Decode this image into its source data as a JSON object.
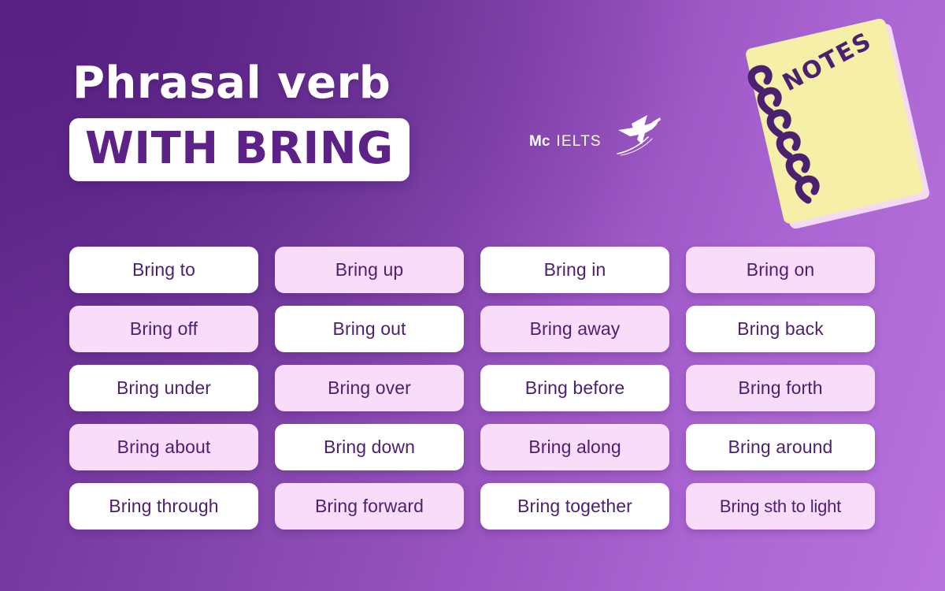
{
  "heading": {
    "line1": "Phrasal verb",
    "line2": "WITH BRING"
  },
  "brand": {
    "mc": "Mc",
    "ielts": "IELTS",
    "icon": "hummingbird-logo-icon"
  },
  "notebook": {
    "label": "NOTES",
    "cover_color": "#f6efa8",
    "page_color": "#f5daf5",
    "spiral_color": "#4b2070"
  },
  "colors": {
    "background_dark": "#6a2c96",
    "background_light": "#b972dc",
    "card_white": "#ffffff",
    "card_pink": "#f9dbfa",
    "text_purple": "#4d2070",
    "title_purple": "#5d2288"
  },
  "cards": [
    {
      "label": "Bring to",
      "style": "white"
    },
    {
      "label": "Bring up",
      "style": "pink"
    },
    {
      "label": "Bring in",
      "style": "white"
    },
    {
      "label": "Bring on",
      "style": "pink"
    },
    {
      "label": "Bring off",
      "style": "pink"
    },
    {
      "label": "Bring out",
      "style": "white"
    },
    {
      "label": "Bring away",
      "style": "pink"
    },
    {
      "label": "Bring back",
      "style": "white"
    },
    {
      "label": "Bring under",
      "style": "white"
    },
    {
      "label": "Bring over",
      "style": "pink"
    },
    {
      "label": "Bring before",
      "style": "white"
    },
    {
      "label": "Bring forth",
      "style": "pink"
    },
    {
      "label": "Bring about",
      "style": "pink"
    },
    {
      "label": "Bring down",
      "style": "white"
    },
    {
      "label": "Bring along",
      "style": "pink"
    },
    {
      "label": "Bring around",
      "style": "white"
    },
    {
      "label": "Bring through",
      "style": "white"
    },
    {
      "label": "Bring forward",
      "style": "pink"
    },
    {
      "label": "Bring together",
      "style": "white"
    },
    {
      "label": "Bring sth to light",
      "style": "pink",
      "tight": true
    }
  ]
}
